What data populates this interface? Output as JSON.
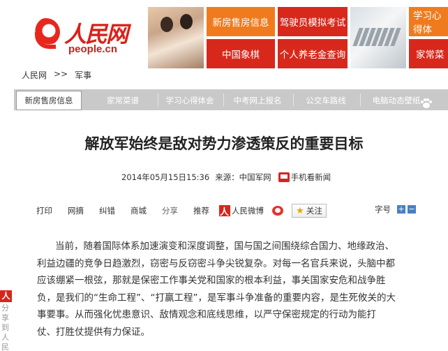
{
  "header": {
    "logo_cn": "人民网",
    "logo_en": "people.cn",
    "ads": [
      {
        "label": "新房售房信息",
        "color": "#f07b1e"
      },
      {
        "label": "驾驶员模拟考试",
        "color": "#d8281c"
      },
      {
        "label": "学习心得体",
        "color": "#f07b1e"
      },
      {
        "label": "中国象棋",
        "color": "#d8281c"
      },
      {
        "label": "个人养老金查询",
        "color": "#d8281c"
      },
      {
        "label": "家常菜",
        "color": "#d8281c"
      }
    ]
  },
  "breadcrumb": {
    "home": "人民网",
    "sep": ">>",
    "section": "军事"
  },
  "nav": {
    "tabs": [
      "新房售房信息",
      "家常菜谱",
      "学习心得体会",
      "中考网上报名",
      "公交车路线",
      "电脑动态壁纸"
    ]
  },
  "article": {
    "title": "解放军始终是敌对势力渗透策反的重要目标",
    "date": "2014年05月15日15:36",
    "source": "来源：中国军网",
    "mobile_news": "手机看新闻",
    "paragraph": [
      "当前，随着国际体系加速演变和深度调整，国与国之间围绕综合国力、地缘政治、",
      "利益边疆的竞争日趋激烈，窃密与反窃密斗争尖锐复杂。对每一名官兵来说，头脑中都",
      "应该绷紧一根弦，那就是保密工作事关党和国家的根本利益，事关国家安危和战争胜",
      "负，是我们的“生命工程”、“打赢工程”，是军事斗争准备的重要内容，是生死攸关的大",
      "事要事。从而强化忧患意识、敌情观念和底线思维，以严守保密规定的行动为能打",
      "仗、打胜仗提供有力保证。"
    ]
  },
  "toolbar": {
    "print": "打印",
    "web_excerpt": "网摘",
    "correct": "纠错",
    "mall": "商城",
    "share": "分享",
    "recommend": "推荐",
    "people_weibo": "人民微博",
    "follow": "关注",
    "font_size": "字号",
    "font_plus": "+",
    "font_minus": "−"
  },
  "share_bar": {
    "logo": "人",
    "text": "分享到人民"
  }
}
